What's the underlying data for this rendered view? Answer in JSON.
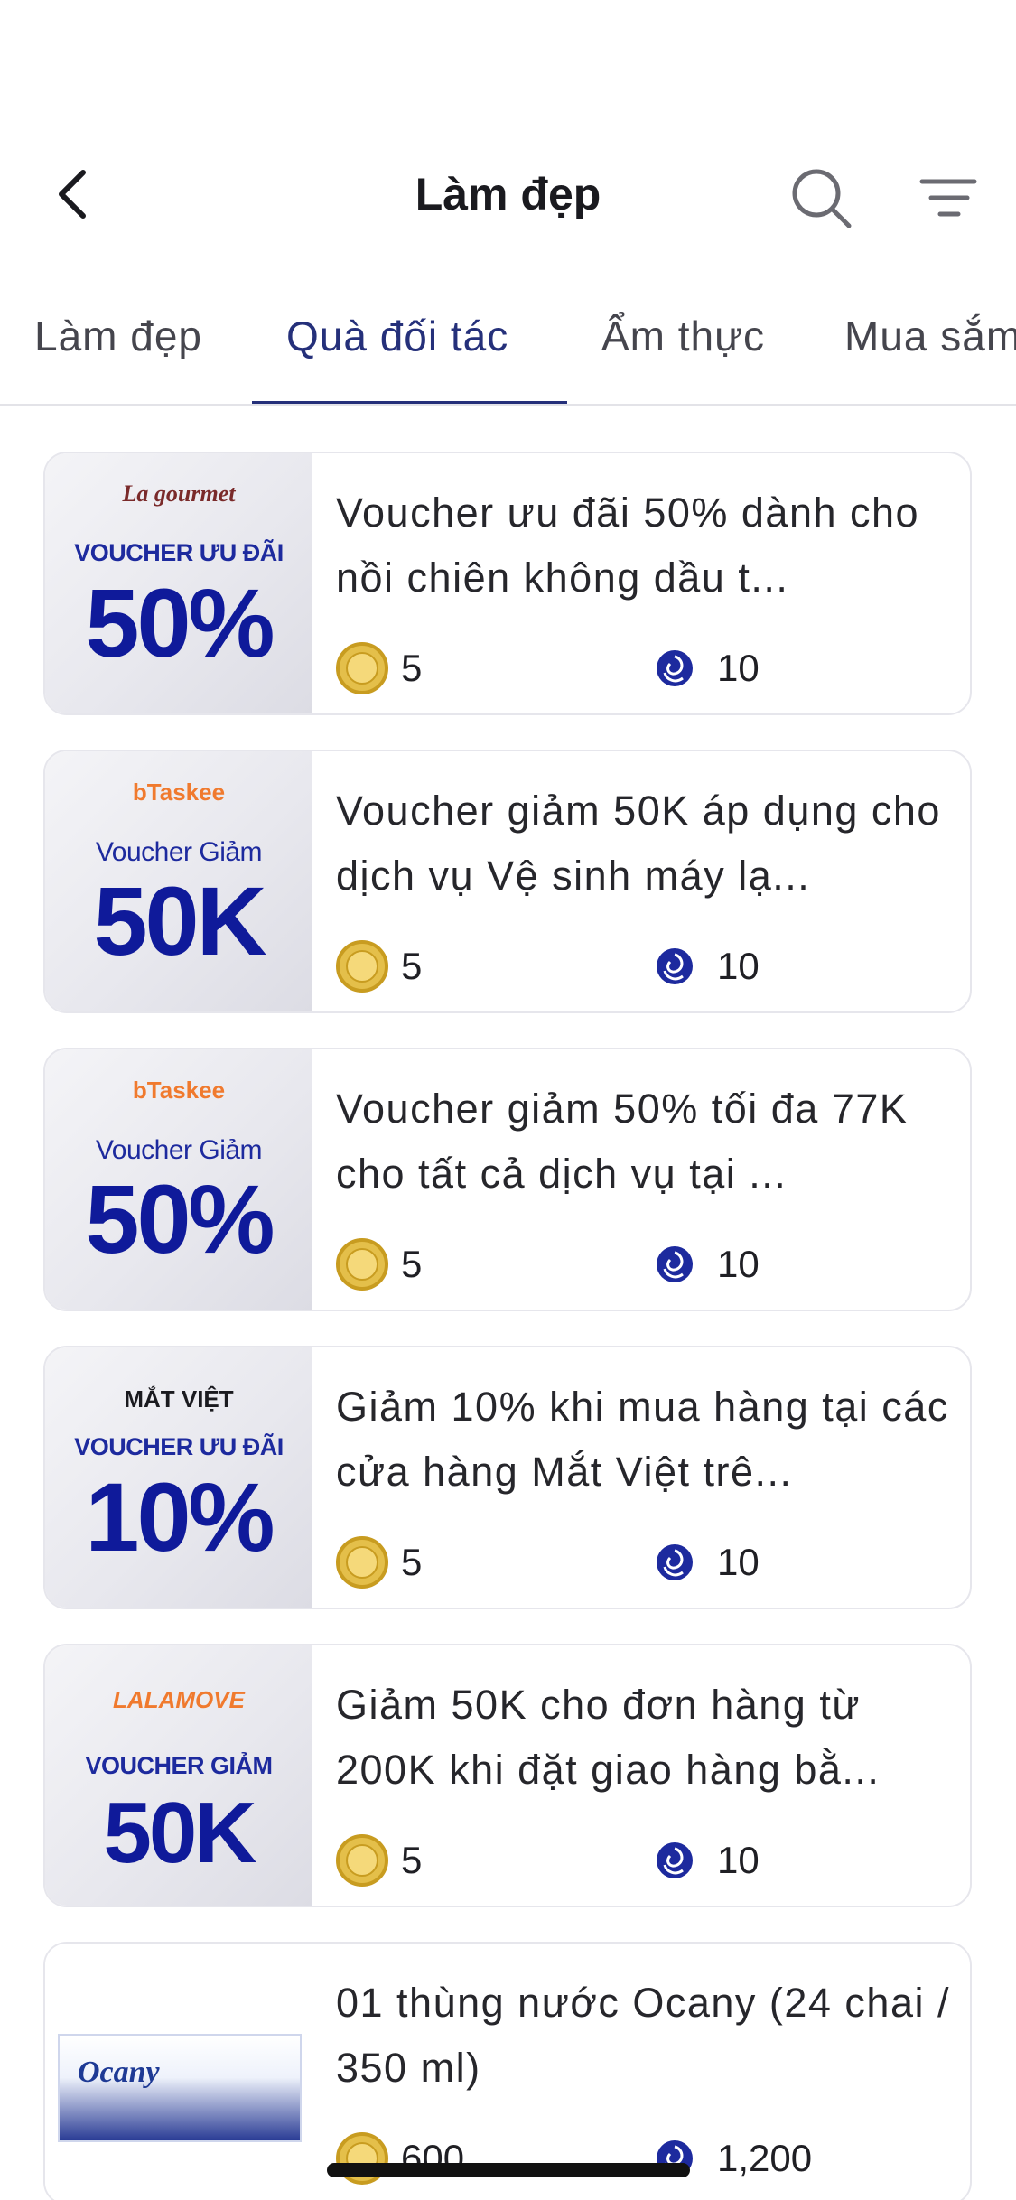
{
  "header": {
    "title": "Làm đẹp"
  },
  "tabs": [
    {
      "label": "Làm đẹp"
    },
    {
      "label": "Quà đối tác"
    },
    {
      "label": "Ẩm thực"
    },
    {
      "label": "Mua sắm"
    }
  ],
  "active_tab": "Quà đối tác",
  "colors": {
    "accent": "#25307a",
    "coin": "#e4bf4a",
    "rose": "#1d2a9e"
  },
  "items": [
    {
      "title": "Voucher ưu đãi 50% dành cho nồi chiên không dầu t...",
      "coin": "5",
      "rose": "10",
      "thumb": {
        "brand": "La gourmet",
        "label": "VOUCHER ƯU ĐÃI",
        "big": "50%"
      }
    },
    {
      "title": "Voucher giảm 50K áp dụng cho dịch vụ Vệ sinh máy lạ...",
      "coin": "5",
      "rose": "10",
      "thumb": {
        "brand": "bTaskee",
        "label": "Voucher Giảm",
        "big": "50K"
      }
    },
    {
      "title": "Voucher giảm 50% tối đa 77K cho tất cả dịch vụ tại ...",
      "coin": "5",
      "rose": "10",
      "thumb": {
        "brand": "bTaskee",
        "label": "Voucher Giảm",
        "big": "50%"
      }
    },
    {
      "title": "Giảm 10% khi mua hàng tại các cửa hàng Mắt Việt trê...",
      "coin": "5",
      "rose": "10",
      "thumb": {
        "brand": "MẮT VIỆT",
        "label": "VOUCHER ƯU ĐÃI",
        "big": "10%"
      }
    },
    {
      "title": "Giảm 50K cho đơn hàng từ 200K khi đặt giao hàng bằ...",
      "coin": "5",
      "rose": "10",
      "thumb": {
        "brand": "LALAMOVE",
        "label": "VOUCHER GIẢM",
        "big": "50K"
      }
    },
    {
      "title": "01 thùng nước Ocany (24 chai / 350 ml)",
      "coin": "600",
      "rose": "1,200",
      "thumb": {
        "brand": "Ocany"
      }
    }
  ],
  "icons": {
    "back": "chevron-left-icon",
    "search": "search-icon",
    "filter": "filter-icon",
    "coin": "coin-icon",
    "rose": "rose-icon"
  }
}
